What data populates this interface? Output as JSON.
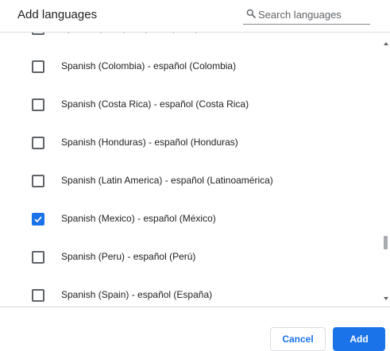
{
  "dialog": {
    "title": "Add languages",
    "search": {
      "placeholder": "Search languages",
      "value": "",
      "icon": "search-icon"
    },
    "languages": [
      {
        "label": "Spanish (Chile) - español (Chile)",
        "checked": false
      },
      {
        "label": "Spanish (Colombia) - español (Colombia)",
        "checked": false
      },
      {
        "label": "Spanish (Costa Rica) - español (Costa Rica)",
        "checked": false
      },
      {
        "label": "Spanish (Honduras) - español (Honduras)",
        "checked": false
      },
      {
        "label": "Spanish (Latin America) - español (Latinoamérica)",
        "checked": false
      },
      {
        "label": "Spanish (Mexico) - español (México)",
        "checked": true
      },
      {
        "label": "Spanish (Peru) - español (Perú)",
        "checked": false
      },
      {
        "label": "Spanish (Spain) - español (España)",
        "checked": false
      }
    ],
    "buttons": {
      "cancel_label": "Cancel",
      "add_label": "Add"
    },
    "colors": {
      "accent": "#1a73e8",
      "text": "#202124",
      "border": "#dadce0"
    }
  }
}
